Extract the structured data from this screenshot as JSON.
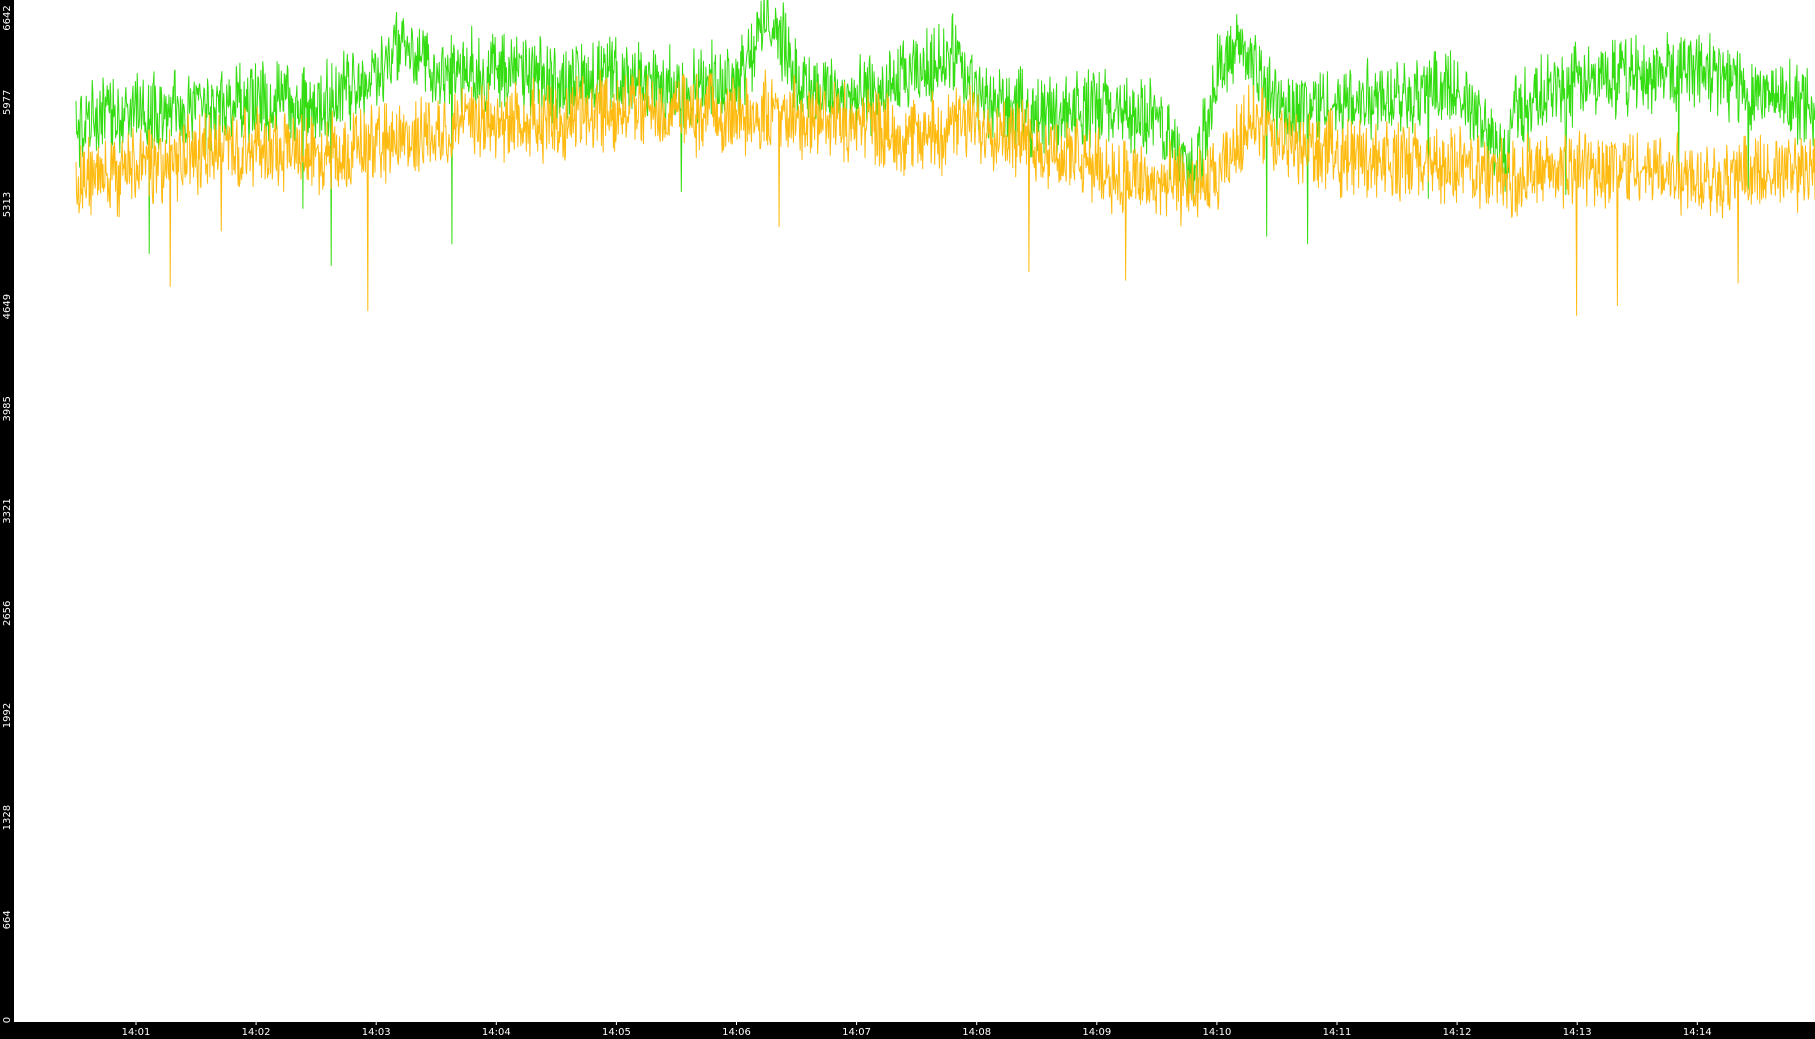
{
  "chart_data": {
    "type": "line",
    "title": "",
    "xlabel": "",
    "ylabel": "",
    "background": "#000000",
    "plot_background": "#ffffff",
    "grid": false,
    "legend": "none",
    "ylim": [
      0,
      6642
    ],
    "y_ticks": [
      "0",
      "664",
      "1328",
      "1992",
      "2656",
      "3321",
      "3985",
      "4649",
      "5313",
      "5977",
      "6642"
    ],
    "x_range_minutes": [
      0.5,
      15.34
    ],
    "x_ticks": [
      {
        "label": "14:01",
        "minute": 1
      },
      {
        "label": "14:02",
        "minute": 2
      },
      {
        "label": "14:03",
        "minute": 3
      },
      {
        "label": "14:04",
        "minute": 4
      },
      {
        "label": "14:05",
        "minute": 5
      },
      {
        "label": "14:06",
        "minute": 6
      },
      {
        "label": "14:07",
        "minute": 7
      },
      {
        "label": "14:08",
        "minute": 8
      },
      {
        "label": "14:09",
        "minute": 9
      },
      {
        "label": "14:10",
        "minute": 10
      },
      {
        "label": "14:11",
        "minute": 11
      },
      {
        "label": "14:12",
        "minute": 12
      },
      {
        "label": "14:13",
        "minute": 13
      },
      {
        "label": "14:14",
        "minute": 14
      }
    ],
    "series": [
      {
        "color": "#33dd11",
        "x_minutes": [
          0.5,
          1.0,
          1.5,
          2.0,
          2.5,
          3.0,
          3.2,
          3.5,
          4.0,
          4.5,
          5.0,
          5.5,
          6.0,
          6.3,
          6.5,
          7.0,
          7.5,
          7.8,
          8.0,
          8.5,
          9.0,
          9.5,
          9.8,
          10.0,
          10.2,
          10.5,
          11.0,
          11.5,
          12.0,
          12.4,
          12.5,
          13.0,
          13.5,
          14.0,
          14.5,
          15.0,
          15.3
        ],
        "values": [
          5800,
          5950,
          5900,
          6000,
          5950,
          6150,
          6380,
          6150,
          6200,
          6100,
          6150,
          6050,
          6150,
          6550,
          6100,
          6000,
          6150,
          6300,
          6000,
          5900,
          5950,
          5850,
          5500,
          6150,
          6350,
          5950,
          5950,
          6050,
          6050,
          5600,
          5950,
          6100,
          6150,
          6200,
          6050,
          5950,
          5900
        ]
      },
      {
        "color": "#ffbb11",
        "x_minutes": [
          0.5,
          1.0,
          1.5,
          2.0,
          2.5,
          3.0,
          3.5,
          4.0,
          4.5,
          5.0,
          5.5,
          6.0,
          6.5,
          7.0,
          7.5,
          8.0,
          8.5,
          9.0,
          9.5,
          10.0,
          10.3,
          10.5,
          11.0,
          11.5,
          12.0,
          12.5,
          13.0,
          13.5,
          14.0,
          14.5,
          15.0,
          15.3
        ],
        "values": [
          5450,
          5550,
          5650,
          5700,
          5650,
          5700,
          5800,
          5850,
          5850,
          5950,
          5900,
          5900,
          5900,
          5850,
          5750,
          5850,
          5700,
          5550,
          5450,
          5450,
          5900,
          5700,
          5650,
          5600,
          5550,
          5500,
          5550,
          5550,
          5500,
          5500,
          5550,
          5550
        ]
      }
    ]
  }
}
